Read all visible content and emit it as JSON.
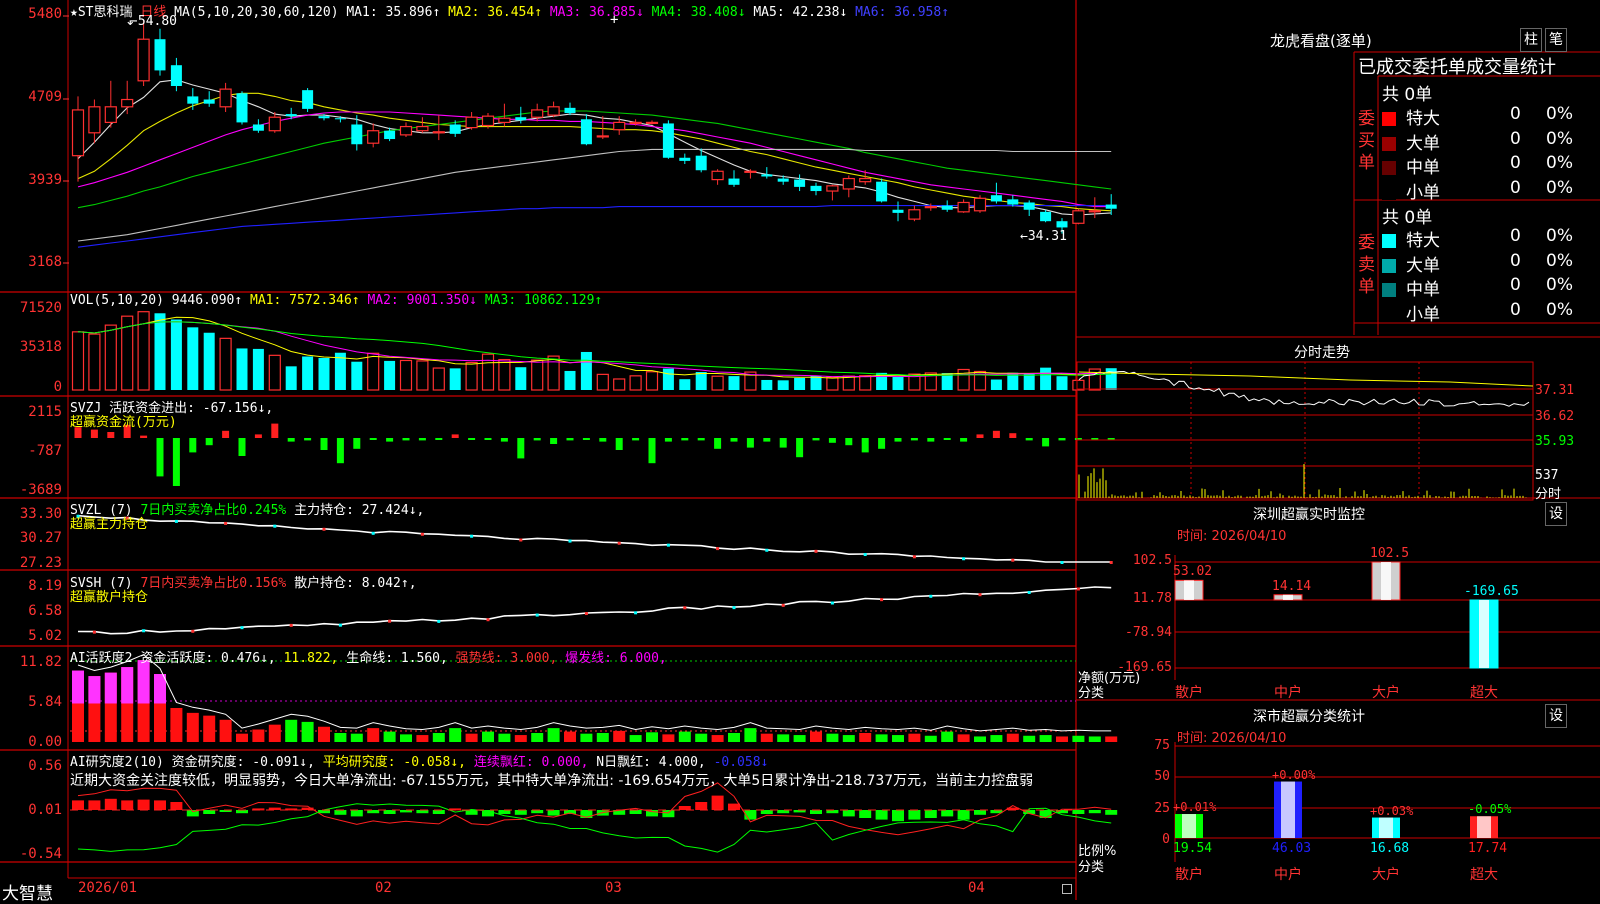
{
  "app": {
    "logo": "大智慧"
  },
  "kline": {
    "header": {
      "name": "★ST思科瑞",
      "period": "日线",
      "ma_label": "MA(5,10,20,30,60,120)",
      "ma1": "MA1: 35.896↑",
      "ma2": "MA2: 36.454↑",
      "ma3": "MA3: 36.885↓",
      "ma4": "MA4: 38.408↓",
      "ma5": "MA5: 42.238↓",
      "ma6": "MA6: 36.958↑"
    },
    "high_label": "54.80",
    "low_label": "34.31",
    "y_ticks": [
      "5480",
      "4709",
      "3939",
      "3168"
    ],
    "candles": [
      {
        "o": 41.8,
        "c": 46.2,
        "h": 47.5,
        "l": 39.3
      },
      {
        "o": 44.0,
        "c": 46.5,
        "h": 47.2,
        "l": 43.0
      },
      {
        "o": 45.0,
        "c": 46.5,
        "h": 49.0,
        "l": 44.5
      },
      {
        "o": 46.5,
        "c": 47.2,
        "h": 49.0,
        "l": 45.8
      },
      {
        "o": 49.0,
        "c": 53.0,
        "h": 54.8,
        "l": 48.5
      },
      {
        "o": 53.0,
        "c": 50.0,
        "h": 54.0,
        "l": 49.5
      },
      {
        "o": 50.5,
        "c": 48.5,
        "h": 51.2,
        "l": 48.0
      },
      {
        "o": 47.5,
        "c": 46.8,
        "h": 48.3,
        "l": 46.2
      },
      {
        "o": 47.2,
        "c": 46.8,
        "h": 48.0,
        "l": 46.5
      },
      {
        "o": 46.5,
        "c": 48.2,
        "h": 48.8,
        "l": 46.0
      },
      {
        "o": 47.8,
        "c": 45.0,
        "h": 48.0,
        "l": 44.8
      },
      {
        "o": 44.8,
        "c": 44.2,
        "h": 45.3,
        "l": 44.0
      },
      {
        "o": 44.2,
        "c": 45.5,
        "h": 46.0,
        "l": 44.0
      },
      {
        "o": 45.8,
        "c": 45.6,
        "h": 46.4,
        "l": 45.3
      },
      {
        "o": 48.1,
        "c": 46.3,
        "h": 48.3,
        "l": 46.0
      },
      {
        "o": 45.6,
        "c": 45.4,
        "h": 45.8,
        "l": 45.2
      },
      {
        "o": 45.4,
        "c": 45.3,
        "h": 45.6,
        "l": 45.0
      },
      {
        "o": 44.8,
        "c": 42.9,
        "h": 45.7,
        "l": 42.3
      },
      {
        "o": 43.0,
        "c": 44.2,
        "h": 44.9,
        "l": 42.6
      },
      {
        "o": 44.2,
        "c": 43.4,
        "h": 44.5,
        "l": 43.2
      },
      {
        "o": 43.8,
        "c": 44.6,
        "h": 45.0,
        "l": 43.6
      },
      {
        "o": 44.2,
        "c": 44.6,
        "h": 45.5,
        "l": 44.0
      },
      {
        "o": 44.0,
        "c": 44.1,
        "h": 45.7,
        "l": 43.3
      },
      {
        "o": 44.8,
        "c": 43.9,
        "h": 45.2,
        "l": 43.6
      },
      {
        "o": 44.5,
        "c": 45.5,
        "h": 46.0,
        "l": 44.3
      },
      {
        "o": 44.7,
        "c": 45.6,
        "h": 45.9,
        "l": 44.4
      },
      {
        "o": 45.0,
        "c": 45.4,
        "h": 46.8,
        "l": 44.6
      },
      {
        "o": 45.5,
        "c": 45.2,
        "h": 46.5,
        "l": 44.9
      },
      {
        "o": 45.5,
        "c": 46.2,
        "h": 46.8,
        "l": 45.1
      },
      {
        "o": 45.7,
        "c": 46.5,
        "h": 47.0,
        "l": 45.5
      },
      {
        "o": 46.4,
        "c": 45.9,
        "h": 46.9,
        "l": 45.7
      },
      {
        "o": 45.3,
        "c": 42.9,
        "h": 45.8,
        "l": 42.8
      },
      {
        "o": 43.7,
        "c": 43.7,
        "h": 45.6,
        "l": 43.4
      },
      {
        "o": 44.3,
        "c": 45.0,
        "h": 45.6,
        "l": 43.8
      },
      {
        "o": 45.0,
        "c": 45.0,
        "h": 45.3,
        "l": 44.7
      },
      {
        "o": 45.0,
        "c": 45.0,
        "h": 45.2,
        "l": 44.8
      },
      {
        "o": 44.9,
        "c": 41.6,
        "h": 45.2,
        "l": 41.5
      },
      {
        "o": 41.6,
        "c": 41.3,
        "h": 42.0,
        "l": 41.0
      },
      {
        "o": 41.8,
        "c": 40.4,
        "h": 42.5,
        "l": 40.2
      },
      {
        "o": 39.5,
        "c": 40.3,
        "h": 40.5,
        "l": 39.0
      },
      {
        "o": 39.6,
        "c": 39.0,
        "h": 40.4,
        "l": 38.8
      },
      {
        "o": 40.2,
        "c": 40.3,
        "h": 40.5,
        "l": 39.6
      },
      {
        "o": 40.0,
        "c": 39.8,
        "h": 40.7,
        "l": 39.6
      },
      {
        "o": 39.6,
        "c": 39.3,
        "h": 39.9,
        "l": 39.0
      },
      {
        "o": 39.5,
        "c": 38.8,
        "h": 40.0,
        "l": 38.4
      },
      {
        "o": 38.9,
        "c": 38.4,
        "h": 39.2,
        "l": 38.0
      },
      {
        "o": 38.4,
        "c": 38.9,
        "h": 39.0,
        "l": 37.5
      },
      {
        "o": 38.6,
        "c": 39.6,
        "h": 39.9,
        "l": 37.8
      },
      {
        "o": 39.3,
        "c": 39.6,
        "h": 40.4,
        "l": 39.0
      },
      {
        "o": 39.3,
        "c": 37.4,
        "h": 39.6,
        "l": 37.3
      },
      {
        "o": 36.6,
        "c": 36.3,
        "h": 37.4,
        "l": 35.5
      },
      {
        "o": 35.7,
        "c": 36.6,
        "h": 37.0,
        "l": 35.5
      },
      {
        "o": 36.9,
        "c": 36.9,
        "h": 37.2,
        "l": 36.5
      },
      {
        "o": 37.0,
        "c": 36.6,
        "h": 37.5,
        "l": 36.4
      },
      {
        "o": 36.4,
        "c": 37.3,
        "h": 37.6,
        "l": 36.3
      },
      {
        "o": 36.5,
        "c": 37.7,
        "h": 38.0,
        "l": 36.3
      },
      {
        "o": 38.0,
        "c": 37.4,
        "h": 39.2,
        "l": 37.2
      },
      {
        "o": 37.6,
        "c": 37.1,
        "h": 38.0,
        "l": 36.9
      },
      {
        "o": 37.3,
        "c": 36.6,
        "h": 37.5,
        "l": 36.0
      },
      {
        "o": 36.4,
        "c": 35.5,
        "h": 36.6,
        "l": 35.4
      },
      {
        "o": 35.5,
        "c": 34.9,
        "h": 35.8,
        "l": 34.3
      },
      {
        "o": 35.3,
        "c": 36.5,
        "h": 36.7,
        "l": 35.2
      },
      {
        "o": 36.5,
        "c": 36.5,
        "h": 37.8,
        "l": 35.8
      },
      {
        "o": 37.1,
        "c": 36.7,
        "h": 38.1,
        "l": 36.1
      }
    ],
    "ma_series": [
      {
        "name": "MA1",
        "color": "#e0e0e0",
        "values": [
          41.5,
          43.1,
          44.8,
          46.4,
          47.4,
          48.9,
          49.1,
          48.6,
          48.2,
          47.8,
          47.1,
          46.5,
          45.8,
          45.6,
          45.7,
          45.7,
          45.5,
          45.3,
          44.8,
          44.4,
          44.2,
          44.0,
          44.0,
          44.1,
          44.5,
          44.8,
          45.0,
          45.2,
          45.4,
          45.6,
          45.8,
          45.7,
          45.4,
          45.3,
          45.0,
          44.7,
          43.9,
          43.1,
          42.3,
          41.6,
          40.9,
          40.3,
          40.0,
          39.8,
          39.6,
          39.4,
          39.1,
          38.9,
          38.7,
          38.3,
          37.8,
          37.4,
          37.0,
          36.8,
          36.8,
          36.9,
          37.0,
          37.0,
          36.9,
          36.6,
          36.2,
          36.1,
          36.2,
          36.3
        ]
      },
      {
        "name": "MA2",
        "color": "#e6e600",
        "values": [
          39.6,
          40.3,
          41.5,
          42.8,
          44.2,
          45.1,
          45.9,
          46.6,
          47.1,
          47.6,
          47.8,
          47.8,
          47.5,
          47.1,
          46.9,
          46.5,
          46.2,
          45.9,
          45.7,
          45.4,
          45.2,
          45.0,
          44.8,
          44.7,
          44.6,
          44.6,
          44.6,
          44.6,
          44.6,
          44.6,
          44.6,
          44.5,
          44.4,
          44.3,
          44.3,
          44.2,
          44.0,
          43.7,
          43.4,
          43.0,
          42.6,
          42.2,
          41.9,
          41.5,
          41.1,
          40.7,
          40.4,
          40.1,
          39.8,
          39.5,
          39.2,
          38.8,
          38.5,
          38.2,
          37.9,
          37.7,
          37.5,
          37.3,
          37.2,
          37.0,
          36.9,
          36.7,
          36.6,
          36.5
        ]
      },
      {
        "name": "MA3",
        "color": "#ff00ff",
        "values": [
          38.8,
          39.2,
          39.7,
          40.2,
          40.8,
          41.4,
          42.0,
          42.6,
          43.2,
          43.8,
          44.3,
          44.7,
          45.1,
          45.4,
          45.7,
          45.9,
          46.0,
          46.0,
          46.0,
          46.0,
          45.9,
          45.8,
          45.7,
          45.6,
          45.5,
          45.4,
          45.3,
          45.3,
          45.2,
          45.2,
          45.1,
          45.1,
          45.0,
          44.9,
          44.8,
          44.6,
          44.4,
          44.2,
          43.9,
          43.6,
          43.3,
          43.0,
          42.6,
          42.2,
          41.8,
          41.4,
          41.0,
          40.6,
          40.2,
          39.9,
          39.6,
          39.3,
          39.0,
          38.8,
          38.6,
          38.4,
          38.2,
          38.0,
          37.8,
          37.6,
          37.4,
          37.1,
          36.9,
          36.9
        ]
      },
      {
        "name": "MA4",
        "color": "#00cc00",
        "values": [
          36.8,
          37.1,
          37.5,
          37.9,
          38.4,
          38.8,
          39.3,
          39.8,
          40.2,
          40.6,
          41.0,
          41.4,
          41.8,
          42.2,
          42.6,
          43.0,
          43.3,
          43.6,
          43.9,
          44.2,
          44.4,
          44.6,
          44.8,
          45.0,
          45.2,
          45.4,
          45.6,
          45.8,
          46.0,
          46.1,
          46.1,
          46.1,
          46.0,
          45.9,
          45.8,
          45.7,
          45.5,
          45.3,
          45.1,
          44.9,
          44.6,
          44.3,
          44.0,
          43.7,
          43.4,
          43.1,
          42.8,
          42.5,
          42.1,
          41.8,
          41.5,
          41.2,
          40.9,
          40.6,
          40.4,
          40.2,
          40.0,
          39.8,
          39.6,
          39.4,
          39.2,
          39.0,
          38.8,
          38.6
        ]
      },
      {
        "name": "MA5",
        "color": "#c0c0c0",
        "values": [
          33.6,
          33.8,
          34.0,
          34.2,
          34.5,
          34.8,
          35.1,
          35.4,
          35.7,
          36.0,
          36.3,
          36.6,
          36.9,
          37.2,
          37.5,
          37.8,
          38.1,
          38.4,
          38.7,
          39.0,
          39.3,
          39.6,
          39.9,
          40.2,
          40.4,
          40.6,
          40.8,
          41.0,
          41.2,
          41.4,
          41.6,
          41.8,
          42.0,
          42.2,
          42.3,
          42.4,
          42.4,
          42.4,
          42.4,
          42.4,
          42.4,
          42.4,
          42.4,
          42.4,
          42.4,
          42.4,
          42.4,
          42.4,
          42.3,
          42.3,
          42.3,
          42.3,
          42.3,
          42.3,
          42.3,
          42.3,
          42.3,
          42.2,
          42.2,
          42.2,
          42.2,
          42.2,
          42.2,
          42.2
        ]
      },
      {
        "name": "MA6",
        "color": "#2020ff",
        "values": [
          33.0,
          33.2,
          33.4,
          33.6,
          33.8,
          34.0,
          34.2,
          34.4,
          34.6,
          34.8,
          35.0,
          35.1,
          35.2,
          35.3,
          35.4,
          35.5,
          35.6,
          35.7,
          35.8,
          35.9,
          36.0,
          36.1,
          36.2,
          36.3,
          36.4,
          36.5,
          36.6,
          36.7,
          36.7,
          36.8,
          36.8,
          36.8,
          36.8,
          36.9,
          36.9,
          36.9,
          36.9,
          36.9,
          36.9,
          36.9,
          36.9,
          36.9,
          36.9,
          36.9,
          36.9,
          36.9,
          37.0,
          37.0,
          37.0,
          37.0,
          37.0,
          37.0,
          37.0,
          37.0,
          37.0,
          37.0,
          37.0,
          37.0,
          37.0,
          37.0,
          37.0,
          37.0,
          37.0,
          37.0
        ]
      }
    ]
  },
  "vol": {
    "header": {
      "label": "VOL(5,10,20)",
      "value": "9446.090↑",
      "ma1": "MA1: 7572.346↑",
      "ma2": "MA2: 9001.350↓",
      "ma3": "MA3: 10862.129↑"
    },
    "y_ticks": [
      "71520",
      "35318",
      "0"
    ]
  },
  "svzj": {
    "header": {
      "label": "SVZJ",
      "text": "活跃资金进出: -67.156↓,",
      "sub": "超赢资金流(万元)"
    },
    "y_ticks": [
      "2115",
      "-787",
      "-3689"
    ]
  },
  "svzl": {
    "header": {
      "label": "SVZL (7)",
      "text1": "7日内买卖净占比0.245%",
      "text2": "主力持仓: 27.424↓,",
      "sub": "超赢主力持仓"
    },
    "y_ticks": [
      "33.30",
      "30.27",
      "27.23"
    ]
  },
  "svsh": {
    "header": {
      "label": "SVSH (7)",
      "text1": "7日内买卖净占比0.156%",
      "text2": "散户持仓: 8.042↑,",
      "sub": "超赢散户持仓"
    },
    "y_ticks": [
      "8.19",
      "6.58",
      "5.02"
    ]
  },
  "ai_active": {
    "header": {
      "label": "AI活跃度2",
      "t1": "资金活跃度: 0.476↓,",
      "t2": "11.822,",
      "t3": "生命线: 1.560,",
      "t4": "强势线: 3.000,",
      "t5": "爆发线: 6.000,"
    },
    "y_ticks": [
      "11.82",
      "5.84",
      "0.00"
    ]
  },
  "ai_research": {
    "header": {
      "label": "AI研究度2(10)",
      "t1": "资金研究度: -0.091↓,",
      "t2": "平均研究度: -0.058↓,",
      "t3": "连续飘红: 0.000,",
      "t4": "N日飘红: 4.000,",
      "t5": "-0.058↓"
    },
    "comment": "近期大资金关注度较低，明显弱势，今日大单净流出: -67.155万元，其中特大单净流出: -169.654万元，大单5日累计净出-218.737万元，当前主力控盘弱",
    "y_ticks": [
      "0.56",
      "0.01",
      "-0.54"
    ]
  },
  "x_axis": {
    "labels": [
      "2026/01",
      "02",
      "03",
      "04"
    ]
  },
  "right": {
    "dragon": {
      "title": "龙虎看盘(逐单)",
      "btn1": "柱",
      "btn2": "笔",
      "table_header": "已成交委托单成交量统计",
      "buy": {
        "side_label": "委买单",
        "total": "共 0单",
        "rows": [
          {
            "label": "特大",
            "value": "0",
            "pct": "0%",
            "color": "#ff0000"
          },
          {
            "label": "大单",
            "value": "0",
            "pct": "0%",
            "color": "#990000"
          },
          {
            "label": "中单",
            "value": "0",
            "pct": "0%",
            "color": "#660000"
          },
          {
            "label": "小单",
            "value": "0",
            "pct": "0%",
            "color": "#000000"
          }
        ]
      },
      "sell": {
        "side_label": "委卖单",
        "total": "共 0单",
        "rows": [
          {
            "label": "特大",
            "value": "0",
            "pct": "0%",
            "color": "#00ffff"
          },
          {
            "label": "大单",
            "value": "0",
            "pct": "0%",
            "color": "#00aaaa"
          },
          {
            "label": "中单",
            "value": "0",
            "pct": "0%",
            "color": "#008080"
          },
          {
            "label": "小单",
            "value": "0",
            "pct": "0%",
            "color": "#000000"
          }
        ]
      }
    },
    "intraday": {
      "title": "分时走势",
      "prices": [
        "37.31",
        "36.62",
        "35.93"
      ],
      "vol": "537",
      "vol_label": "分时"
    },
    "monitor": {
      "title": "深圳超赢实时监控",
      "btn": "设",
      "time": "时间: 2026/04/10",
      "y_ticks": [
        "102.5",
        "11.78",
        "-78.94",
        "-169.65"
      ],
      "bars": [
        {
          "label": "散户",
          "value": 53.02,
          "text": "53.02"
        },
        {
          "label": "中户",
          "value": 14.14,
          "text": "14.14"
        },
        {
          "label": "大户",
          "value": 102.5,
          "text": "102.5"
        },
        {
          "label": "超大",
          "value": -169.65,
          "text": "-169.65"
        }
      ],
      "axis_label1": "净额(万元)",
      "axis_label2": "分类"
    },
    "classify": {
      "title": "深市超赢分类统计",
      "btn": "设",
      "time": "时间: 2026/04/10",
      "y_ticks": [
        "75",
        "50",
        "25",
        "0"
      ],
      "bars": [
        {
          "label": "散户",
          "value": 19.54,
          "text": "19.54",
          "delta": "+0.01%",
          "color": "#00ff00"
        },
        {
          "label": "中户",
          "value": 46.03,
          "text": "46.03",
          "delta": "+0.00%",
          "color": "#2020ff"
        },
        {
          "label": "大户",
          "value": 16.68,
          "text": "16.68",
          "delta": "+0.03%",
          "color": "#00ffff"
        },
        {
          "label": "超大",
          "value": 17.74,
          "text": "17.74",
          "delta": "-0.05%",
          "color": "#ff2020"
        }
      ],
      "axis_label1": "比例%",
      "axis_label2": "分类"
    }
  }
}
